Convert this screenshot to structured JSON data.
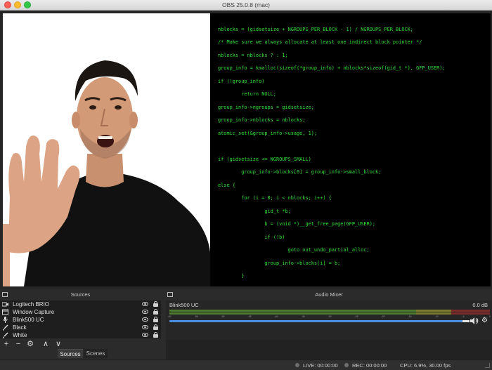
{
  "window": {
    "title": "OBS 25.0.8 (mac)"
  },
  "preview": {
    "code_lines": [
      "nblocks = (gidsetsize + NGROUPS_PER_BLOCK - 1) / NGROUPS_PER_BLOCK;",
      "/* Make sure we always allocate at least one indirect block pointer */",
      "nblocks = nblocks ? : 1;",
      "group_info = kmalloc(sizeof(*group_info) + nblocks*sizeof(gid_t *), GFP_USER);",
      "if (!group_info)",
      "        return NULL;",
      "group_info->ngroups = gidsetsize;",
      "group_info->nblocks = nblocks;",
      "atomic_set(&group_info->usage, 1);",
      "",
      "if (gidsetsize <= NGROUPS_SMALL)",
      "        group_info->blocks[0] = group_info->small_block;",
      "else {",
      "        for (i = 0; i < nblocks; i++) {",
      "                gid_t *b;",
      "                b = (void *)__get_free_page(GFP_USER);",
      "                if (!b)",
      "                        goto out_undo_partial_alloc;",
      "                group_info->blocks[i] = b;",
      "        }"
    ],
    "code_color": "#33e13a"
  },
  "sources_dock": {
    "title": "Sources",
    "items": [
      {
        "label": "Logitech BRIO",
        "icon": "camera-icon"
      },
      {
        "label": "Window Capture",
        "icon": "window-icon"
      },
      {
        "label": "Blink500 UC",
        "icon": "microphone-icon"
      },
      {
        "label": "Black",
        "icon": "brush-icon"
      },
      {
        "label": "White",
        "icon": "brush-icon"
      }
    ],
    "toolbar": {
      "add": "+",
      "remove": "−",
      "settings": "⚙",
      "up": "∧",
      "down": "∨"
    },
    "tabs": {
      "sources": "Sources",
      "scenes": "Scenes"
    }
  },
  "audio_mixer": {
    "title": "Audio Mixer",
    "channel": {
      "name": "Blink500 UC",
      "db": "0.0 dB",
      "volume_percent": 100
    },
    "scale": [
      "-60",
      "-55",
      "-50",
      "-45",
      "-40",
      "-35",
      "-30",
      "-25",
      "-20",
      "-15",
      "-10",
      "-5",
      "0"
    ],
    "colors": {
      "green": "#4d7b2d",
      "yellow": "#7b7b2b",
      "red": "#7d2b2b",
      "fader": "#4a90e2"
    }
  },
  "status": {
    "live": "LIVE: 00:00:00",
    "rec": "REC: 00:00:00",
    "cpu": "CPU: 6.9%, 30.00 fps"
  }
}
